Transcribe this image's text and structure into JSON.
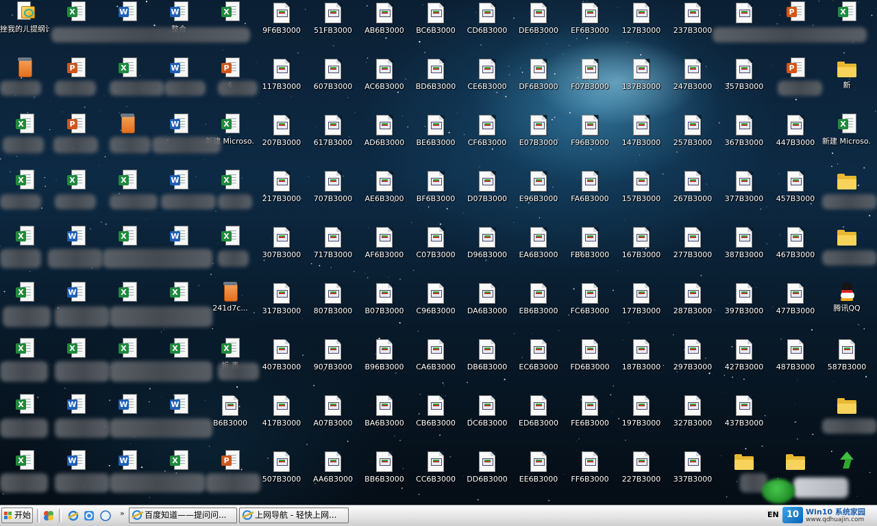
{
  "desktop": {
    "icons": [
      {
        "label": "挫我的ㄦ提纲计 被他的er...",
        "type": "special"
      },
      {
        "label": "",
        "type": "excel"
      },
      {
        "label": "",
        "type": "word"
      },
      {
        "label": "整合",
        "type": "word"
      },
      {
        "label": "",
        "type": "excel"
      },
      {
        "label": "9F6B3000",
        "type": "doc"
      },
      {
        "label": "51FB3000",
        "type": "doc"
      },
      {
        "label": "AB6B3000",
        "type": "doc"
      },
      {
        "label": "BC6B3000",
        "type": "doc"
      },
      {
        "label": "CD6B3000",
        "type": "doc"
      },
      {
        "label": "DE6B3000",
        "type": "doc"
      },
      {
        "label": "EF6B3000",
        "type": "doc"
      },
      {
        "label": "127B3000",
        "type": "doc"
      },
      {
        "label": "237B3000",
        "type": "doc"
      },
      {
        "label": "",
        "type": "doc"
      },
      {
        "label": "",
        "type": "ppt"
      },
      {
        "label": "",
        "type": "excel"
      },
      {
        "label": "",
        "type": "box"
      },
      {
        "label": "",
        "type": "ppt"
      },
      {
        "label": "",
        "type": "excel"
      },
      {
        "label": "",
        "type": "word"
      },
      {
        "label": "6",
        "type": "ppt"
      },
      {
        "label": "117B3000",
        "type": "doc"
      },
      {
        "label": "607B3000",
        "type": "doc"
      },
      {
        "label": "AC6B3000",
        "type": "doc"
      },
      {
        "label": "BD6B3000",
        "type": "doc"
      },
      {
        "label": "CE6B3000",
        "type": "doc"
      },
      {
        "label": "DF6B3000",
        "type": "doc"
      },
      {
        "label": "F07B3000",
        "type": "doc"
      },
      {
        "label": "137B3000",
        "type": "doc"
      },
      {
        "label": "247B3000",
        "type": "doc"
      },
      {
        "label": "357B3000",
        "type": "doc"
      },
      {
        "label": "",
        "type": "ppt"
      },
      {
        "label": "新",
        "type": "folder"
      },
      {
        "label": "",
        "type": "excel"
      },
      {
        "label": "",
        "type": "ppt"
      },
      {
        "label": "",
        "type": "box"
      },
      {
        "label": "",
        "type": "word"
      },
      {
        "label": "新建 Microso...",
        "type": "excel"
      },
      {
        "label": "207B3000",
        "type": "doc"
      },
      {
        "label": "617B3000",
        "type": "doc"
      },
      {
        "label": "AD6B3000",
        "type": "doc"
      },
      {
        "label": "BE6B3000",
        "type": "doc"
      },
      {
        "label": "CF6B3000",
        "type": "doc"
      },
      {
        "label": "E07B3000",
        "type": "doc"
      },
      {
        "label": "F96B3000",
        "type": "doc"
      },
      {
        "label": "147B3000",
        "type": "doc"
      },
      {
        "label": "257B3000",
        "type": "doc"
      },
      {
        "label": "367B3000",
        "type": "doc"
      },
      {
        "label": "447B3000",
        "type": "doc"
      },
      {
        "label": "新建 Microso...",
        "type": "excel"
      },
      {
        "label": "",
        "type": "excel"
      },
      {
        "label": "",
        "type": "excel"
      },
      {
        "label": "",
        "type": "excel"
      },
      {
        "label": "",
        "type": "word"
      },
      {
        "label": "",
        "type": "excel"
      },
      {
        "label": "217B3000",
        "type": "doc"
      },
      {
        "label": "707B3000",
        "type": "doc"
      },
      {
        "label": "AE6B3000",
        "type": "doc"
      },
      {
        "label": "BF6B3000",
        "type": "doc"
      },
      {
        "label": "D07B3000",
        "type": "doc"
      },
      {
        "label": "E96B3000",
        "type": "doc"
      },
      {
        "label": "FA6B3000",
        "type": "doc"
      },
      {
        "label": "157B3000",
        "type": "doc"
      },
      {
        "label": "267B3000",
        "type": "doc"
      },
      {
        "label": "377B3000",
        "type": "doc"
      },
      {
        "label": "457B3000",
        "type": "doc"
      },
      {
        "label": "",
        "type": "folder"
      },
      {
        "label": "",
        "type": "excel"
      },
      {
        "label": "",
        "type": "word"
      },
      {
        "label": "",
        "type": "excel"
      },
      {
        "label": "",
        "type": "word"
      },
      {
        "label": "",
        "type": "excel"
      },
      {
        "label": "307B3000",
        "type": "doc"
      },
      {
        "label": "717B3000",
        "type": "doc"
      },
      {
        "label": "AF6B3000",
        "type": "doc"
      },
      {
        "label": "C07B3000",
        "type": "doc"
      },
      {
        "label": "D96B3000",
        "type": "doc"
      },
      {
        "label": "EA6B3000",
        "type": "doc"
      },
      {
        "label": "FB6B3000",
        "type": "doc"
      },
      {
        "label": "167B3000",
        "type": "doc"
      },
      {
        "label": "277B3000",
        "type": "doc"
      },
      {
        "label": "387B3000",
        "type": "doc"
      },
      {
        "label": "467B3000",
        "type": "doc"
      },
      {
        "label": "",
        "type": "folder"
      },
      {
        "label": "",
        "type": "excel"
      },
      {
        "label": "",
        "type": "word"
      },
      {
        "label": "",
        "type": "excel"
      },
      {
        "label": "",
        "type": "excel"
      },
      {
        "label": "241d7c...",
        "type": "box"
      },
      {
        "label": "317B3000",
        "type": "doc"
      },
      {
        "label": "807B3000",
        "type": "doc"
      },
      {
        "label": "B07B3000",
        "type": "doc"
      },
      {
        "label": "C96B3000",
        "type": "doc"
      },
      {
        "label": "DA6B3000",
        "type": "doc"
      },
      {
        "label": "EB6B3000",
        "type": "doc"
      },
      {
        "label": "FC6B3000",
        "type": "doc"
      },
      {
        "label": "177B3000",
        "type": "doc"
      },
      {
        "label": "287B3000",
        "type": "doc"
      },
      {
        "label": "397B3000",
        "type": "doc"
      },
      {
        "label": "477B3000",
        "type": "doc"
      },
      {
        "label": "腾讯QQ",
        "type": "qq"
      },
      {
        "label": "",
        "type": "excel"
      },
      {
        "label": "",
        "type": "excel"
      },
      {
        "label": "",
        "type": "excel"
      },
      {
        "label": "",
        "type": "excel"
      },
      {
        "label": "折 表",
        "type": "excel"
      },
      {
        "label": "407B3000",
        "type": "doc"
      },
      {
        "label": "907B3000",
        "type": "doc"
      },
      {
        "label": "B96B3000",
        "type": "doc"
      },
      {
        "label": "CA6B3000",
        "type": "doc"
      },
      {
        "label": "DB6B3000",
        "type": "doc"
      },
      {
        "label": "EC6B3000",
        "type": "doc"
      },
      {
        "label": "FD6B3000",
        "type": "doc"
      },
      {
        "label": "187B3000",
        "type": "doc"
      },
      {
        "label": "297B3000",
        "type": "doc"
      },
      {
        "label": "427B3000",
        "type": "doc"
      },
      {
        "label": "487B3000",
        "type": "doc"
      },
      {
        "label": "587B3000",
        "type": "doc"
      },
      {
        "label": "",
        "type": "excel"
      },
      {
        "label": "",
        "type": "word"
      },
      {
        "label": "",
        "type": "word"
      },
      {
        "label": "",
        "type": "word"
      },
      {
        "label": "B6B3000",
        "type": "doc"
      },
      {
        "label": "417B3000",
        "type": "doc"
      },
      {
        "label": "A07B3000",
        "type": "doc"
      },
      {
        "label": "BA6B3000",
        "type": "doc"
      },
      {
        "label": "CB6B3000",
        "type": "doc"
      },
      {
        "label": "DC6B3000",
        "type": "doc"
      },
      {
        "label": "ED6B3000",
        "type": "doc"
      },
      {
        "label": "FE6B3000",
        "type": "doc"
      },
      {
        "label": "197B3000",
        "type": "doc"
      },
      {
        "label": "327B3000",
        "type": "doc"
      },
      {
        "label": "437B3000",
        "type": "doc"
      },
      {
        "label": "-",
        "type": "none"
      },
      {
        "label": "",
        "type": "folder"
      },
      {
        "label": "",
        "type": "excel"
      },
      {
        "label": "",
        "type": "word"
      },
      {
        "label": "",
        "type": "word"
      },
      {
        "label": "",
        "type": "excel"
      },
      {
        "label": "",
        "type": "ppt"
      },
      {
        "label": "507B3000",
        "type": "doc"
      },
      {
        "label": "AA6B3000",
        "type": "doc"
      },
      {
        "label": "BB6B3000",
        "type": "doc"
      },
      {
        "label": "CC6B3000",
        "type": "doc"
      },
      {
        "label": "DD6B3000",
        "type": "doc"
      },
      {
        "label": "EE6B3000",
        "type": "doc"
      },
      {
        "label": "FF6B3000",
        "type": "doc"
      },
      {
        "label": "227B3000",
        "type": "doc"
      },
      {
        "label": "337B3000",
        "type": "doc"
      },
      {
        "label": "",
        "type": "folder"
      },
      {
        "label": "",
        "type": "folder"
      },
      {
        "label": "",
        "type": "arrow"
      }
    ]
  },
  "taskbar": {
    "start_label": "开始",
    "overflow_chevron": "»",
    "tasks": [
      {
        "label": "百度知道——提问问..."
      },
      {
        "label": "上网导航 - 轻快上网..."
      }
    ],
    "tray_lang": "EN",
    "watermark_logo": "10",
    "watermark_title": "Win10 系统家园",
    "watermark_url": "www.qdhuajin.com"
  },
  "colors": {
    "taskbar_bg": "#e7e7e7",
    "excel_badge": "#1f8a3c",
    "word_badge": "#1f5fb8",
    "ppt_badge": "#d2561c",
    "folder": "#f7d35b"
  }
}
